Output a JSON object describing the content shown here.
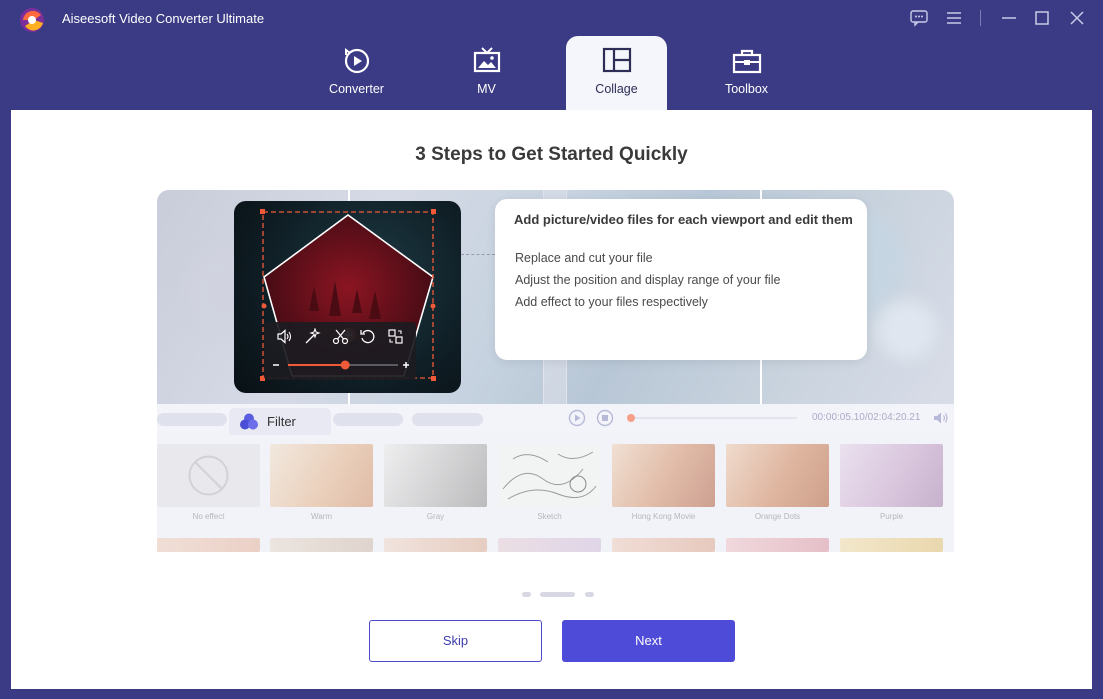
{
  "app": {
    "title": "Aiseesoft Video Converter Ultimate"
  },
  "nav": {
    "tabs": [
      {
        "label": "Converter",
        "icon": "converter-icon"
      },
      {
        "label": "MV",
        "icon": "mv-icon"
      },
      {
        "label": "Collage",
        "icon": "collage-icon",
        "active": true
      },
      {
        "label": "Toolbox",
        "icon": "toolbox-icon"
      }
    ]
  },
  "main": {
    "heading": "3 Steps to Get Started Quickly",
    "tooltip": {
      "title": "Add picture/video files for each viewport and edit them",
      "lines": [
        "Replace and cut your file",
        "Adjust the position and display range of your file",
        "Add effect to your files respectively"
      ]
    },
    "filter_tab": "Filter",
    "playback_time": "00:00:05.10/02:04:20.21",
    "filters": [
      "No effect",
      "Warm",
      "Gray",
      "Sketch",
      "Hong Kong Movie",
      "Orange Dots",
      "Purple"
    ],
    "video_slider_level": 0.52,
    "pager": {
      "pages": 3,
      "current": 2
    },
    "buttons": {
      "skip": "Skip",
      "next": "Next"
    }
  },
  "colors": {
    "titlebar_bg": "#3b3b85",
    "accent": "#4e4bd8",
    "highlight": "#f15a38"
  }
}
